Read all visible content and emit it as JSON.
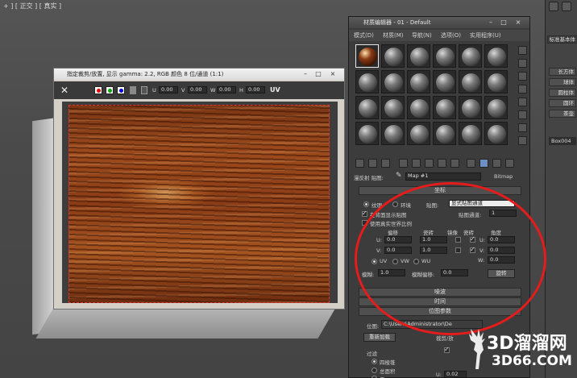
{
  "viewport": {
    "label": "+ ] [ 正交 ] [ 真实 ]"
  },
  "image_window": {
    "title": "指定裁剪/放置, 显示 gamma: 2.2, RGB 颜色 8 位/通道 (1:1)",
    "controls": {
      "u_label": "U",
      "u_value": "0.00",
      "v_label": "V",
      "v_value": "0.00",
      "w_label": "W",
      "w_value": "0.00",
      "h_label": "H",
      "h_value": "0.00",
      "uv_label": "UV"
    }
  },
  "material_editor": {
    "title": "材质编辑器 - 01 - Default",
    "menu": [
      "模式(D)",
      "材质(M)",
      "导航(N)",
      "选项(O)",
      "实用程序(U)"
    ],
    "map_row": {
      "label": "漫反射 贴图:",
      "value": "Map #1",
      "type": "Bitmap"
    },
    "coords": {
      "header": "坐标",
      "texture_label": "纹理",
      "env_label": "环境",
      "mapping_label": "贴图:",
      "mapping_value": "显式贴图通道",
      "show_on_back": "在背面显示贴图",
      "real_world": "使用真实世界比例",
      "map_channel_label": "贴图通道:",
      "map_channel_value": "1",
      "col_offset": "偏移",
      "col_tiling": "瓷砖",
      "col_mirror": "镜像",
      "col_tile": "瓷砖",
      "col_angle": "角度",
      "u_label": "U:",
      "v_label": "V:",
      "w_label": "W:",
      "u_offset": "0.0",
      "v_offset": "0.0",
      "u_tiling": "1.0",
      "v_tiling": "1.0",
      "u_angle": "0.0",
      "v_angle": "0.0",
      "w_angle": "0.0",
      "uv": "UV",
      "vw": "VW",
      "wu": "WU",
      "blur_label": "模糊:",
      "blur_value": "1.0",
      "blur_offset_label": "模糊偏移:",
      "blur_offset_value": "0.0",
      "rotate_button": "旋转"
    },
    "rollouts": {
      "noise": "噪波",
      "time": "时间",
      "bitmap_params": "位图参数"
    },
    "bitmap": {
      "path_label": "位图:",
      "path_value": "C:\\Users\\Administrator\\De",
      "reload": "重新加载",
      "crop_label": "裁剪/放",
      "filter_label": "过滤",
      "filter_pyramid": "四棱锥",
      "filter_sat": "总面积",
      "filter_none": "无",
      "u_label": "U:",
      "u_value": "0.02"
    }
  },
  "command_panel": {
    "header": "标准基本体",
    "items": [
      "长方体",
      "球体",
      "圆柱体",
      "圆环",
      "茶壶"
    ],
    "name_field": "Box004"
  },
  "watermark": {
    "line1": "3D溜溜网",
    "line2": "3D66.COM"
  }
}
